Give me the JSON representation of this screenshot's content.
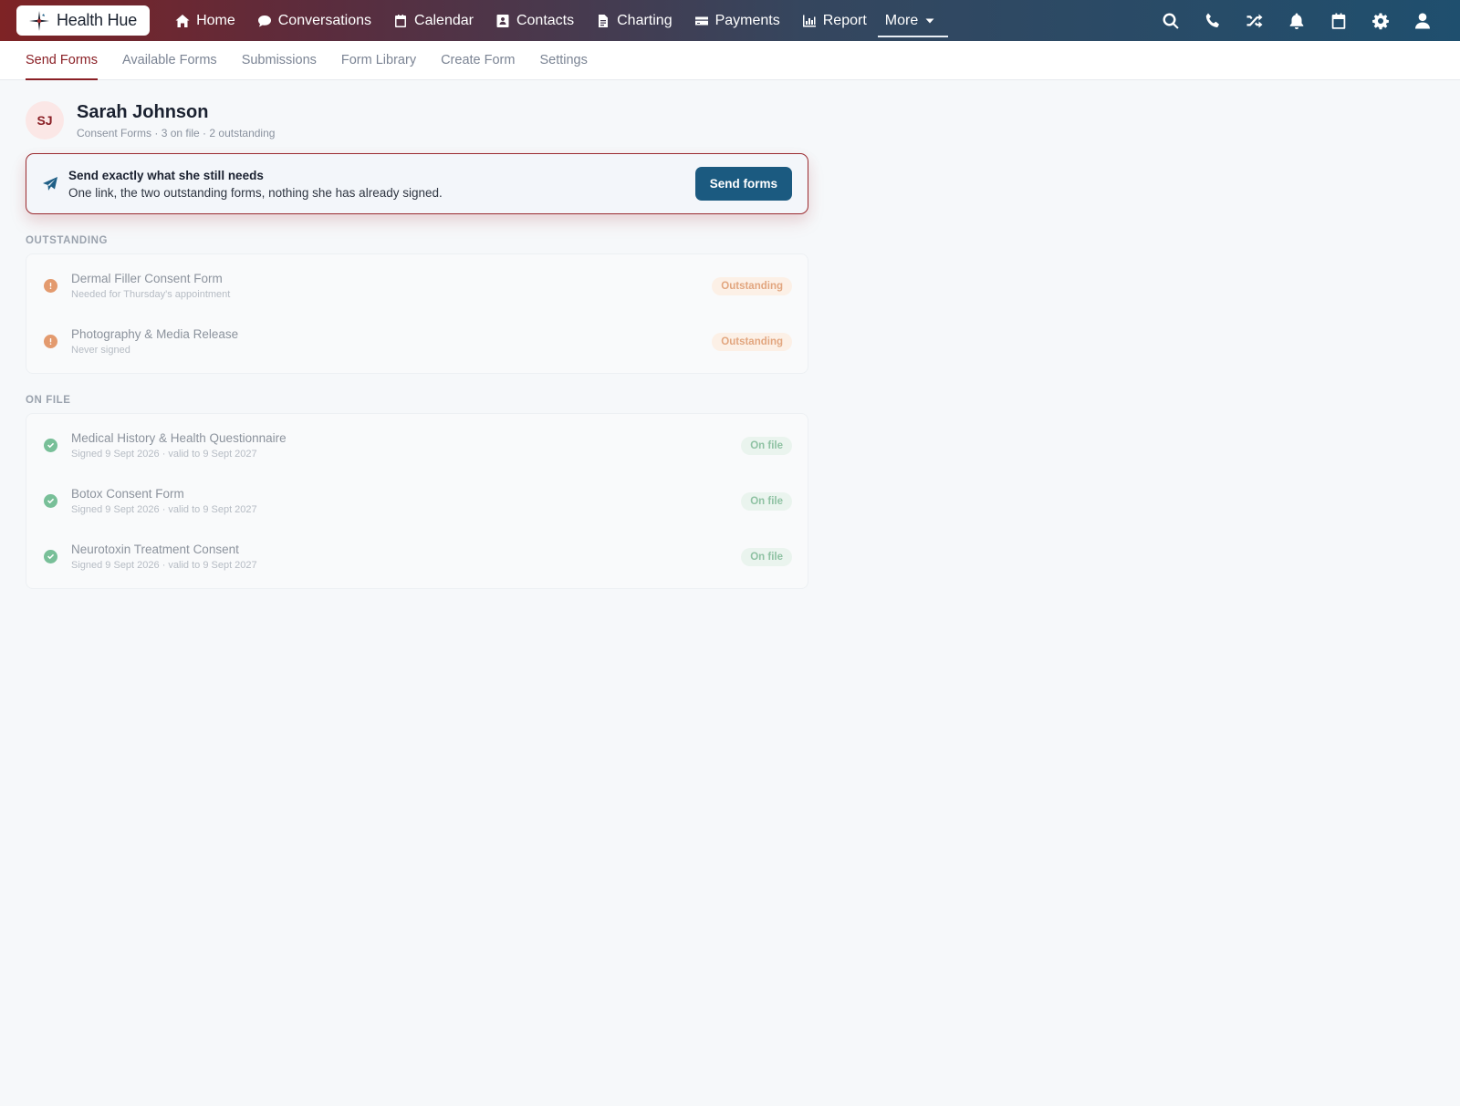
{
  "app": {
    "logo_text": "Health Hue"
  },
  "nav": {
    "items": [
      {
        "label": "Home",
        "icon": "home-icon"
      },
      {
        "label": "Conversations",
        "icon": "chat-icon"
      },
      {
        "label": "Calendar",
        "icon": "calendar-icon"
      },
      {
        "label": "Contacts",
        "icon": "contact-card-icon"
      },
      {
        "label": "Charting",
        "icon": "document-icon"
      },
      {
        "label": "Payments",
        "icon": "credit-card-icon"
      },
      {
        "label": "Report",
        "icon": "bar-chart-icon"
      }
    ],
    "more_label": "More",
    "right_icons": [
      "search-icon",
      "phone-icon",
      "shuffle-icon",
      "bell-icon",
      "calendar-icon",
      "gear-icon",
      "user-icon"
    ]
  },
  "subtabs": {
    "items": [
      "Send Forms",
      "Available Forms",
      "Submissions",
      "Form Library",
      "Create Form",
      "Settings"
    ],
    "active": "Send Forms"
  },
  "patient": {
    "initials": "SJ",
    "name": "Sarah Johnson",
    "meta": "Consent Forms · 3 on file · 2 outstanding"
  },
  "banner": {
    "title": "Send exactly what she still needs",
    "subtitle": "One link, the two outstanding forms, nothing she has already signed.",
    "button_label": "Send forms"
  },
  "outstanding": {
    "label": "OUTSTANDING",
    "rows": [
      {
        "title": "Dermal Filler Consent Form",
        "sub": "Needed for Thursday's appointment",
        "status": "Outstanding"
      },
      {
        "title": "Photography & Media Release",
        "sub": "Never signed",
        "status": "Outstanding"
      }
    ]
  },
  "on_file": {
    "label": "ON FILE",
    "rows": [
      {
        "title": "Medical History & Health Questionnaire",
        "sub": "Signed 9 Sept 2026 · valid to 9 Sept 2027",
        "status": "On file"
      },
      {
        "title": "Botox Consent Form",
        "sub": "Signed 9 Sept 2026 · valid to 9 Sept 2027",
        "status": "On file"
      },
      {
        "title": "Neurotoxin Treatment Consent",
        "sub": "Signed 9 Sept 2026 · valid to 9 Sept 2027",
        "status": "On file"
      }
    ]
  },
  "colors": {
    "brand_red": "#8a1f25",
    "brand_blue": "#1b5a80",
    "warn": "#e39a6e",
    "ok": "#78bf98"
  }
}
